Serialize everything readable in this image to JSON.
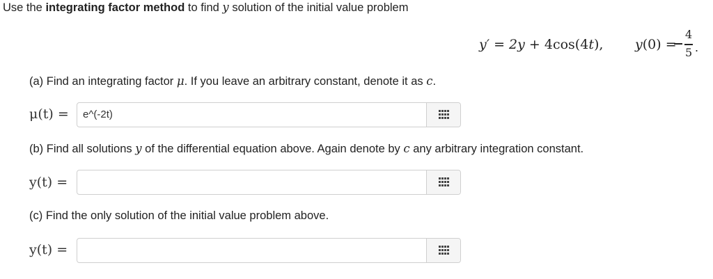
{
  "intro": {
    "t1": "Use the ",
    "bold": "integrating factor method",
    "t2": " to find ",
    "var": "y",
    "t3": " solution of the initial value problem"
  },
  "equation": {
    "lhs": "y′ = 2",
    "y": "y",
    "mid": " + 4",
    "cos": "cos(4",
    "t": "t",
    "end": "),"
  },
  "initial": {
    "y": "y",
    "arg": "(0) = ",
    "minus": "−",
    "num": "4",
    "den": "5",
    "dot": "."
  },
  "part_a": {
    "t1": "(a) Find an integrating factor ",
    "mu": "μ",
    "t2": ". If you leave an arbitrary constant, denote it as ",
    "c": "c",
    "t3": ".",
    "label": "μ(t) =",
    "value": "e^(-2t)"
  },
  "part_b": {
    "t1": "(b) Find all solutions ",
    "y": "y",
    "t2": " of the differential equation above. Again denote by ",
    "c": "c",
    "t3": " any arbitrary integration constant.",
    "label": "y(t) =",
    "value": ""
  },
  "part_c": {
    "text": "(c) Find the only solution of the initial value problem above.",
    "label": "y(t) =",
    "value": ""
  },
  "icons": {
    "keypad": "keypad-icon"
  }
}
